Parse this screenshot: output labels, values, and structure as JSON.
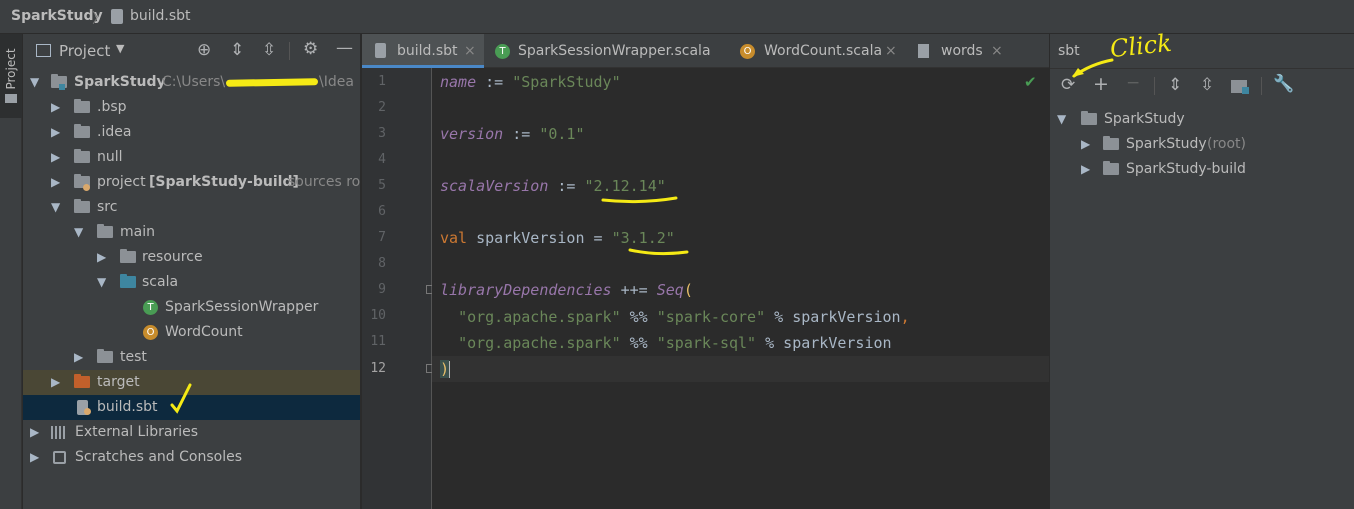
{
  "breadcrumb": {
    "project": "SparkStudy",
    "file": "build.sbt"
  },
  "left_strip": {
    "tab_label": "Project"
  },
  "project_panel": {
    "header_label": "Project",
    "tree": [
      {
        "label": "SparkStudy",
        "extra": "C:\\Users\\",
        "extra2": "\\Idea",
        "level": 0,
        "expanded": true,
        "icon": "module-folder"
      },
      {
        "label": ".bsp",
        "level": 1,
        "expanded": false,
        "icon": "folder"
      },
      {
        "label": ".idea",
        "level": 1,
        "expanded": false,
        "icon": "folder"
      },
      {
        "label": "null",
        "level": 1,
        "expanded": false,
        "icon": "folder"
      },
      {
        "label": "project",
        "bold": "[SparkStudy-build]",
        "extra": "sources roo",
        "level": 1,
        "expanded": false,
        "icon": "folder"
      },
      {
        "label": "src",
        "level": 1,
        "expanded": true,
        "icon": "folder"
      },
      {
        "label": "main",
        "level": 2,
        "expanded": true,
        "icon": "folder"
      },
      {
        "label": "resource",
        "level": 3,
        "expanded": false,
        "icon": "folder"
      },
      {
        "label": "scala",
        "level": 3,
        "expanded": true,
        "icon": "folder-blue"
      },
      {
        "label": "SparkSessionWrapper",
        "level": 4,
        "icon": "trait"
      },
      {
        "label": "WordCount",
        "level": 4,
        "icon": "object"
      },
      {
        "label": "test",
        "level": 2,
        "expanded": false,
        "icon": "folder"
      },
      {
        "label": "target",
        "level": 1,
        "expanded": false,
        "icon": "folder-orange"
      },
      {
        "label": "build.sbt",
        "level": 1,
        "icon": "sbt-file"
      },
      {
        "label": "External Libraries",
        "level": 0,
        "expanded": false,
        "icon": "libraries"
      },
      {
        "label": "Scratches and Consoles",
        "level": 0,
        "expanded": false,
        "icon": "scratches"
      }
    ]
  },
  "editor": {
    "tabs": [
      {
        "label": "build.sbt",
        "active": true
      },
      {
        "label": "SparkSessionWrapper.scala",
        "active": false
      },
      {
        "label": "WordCount.scala",
        "active": false
      },
      {
        "label": "words",
        "active": false
      }
    ],
    "line_numbers": [
      "1",
      "2",
      "3",
      "4",
      "5",
      "6",
      "7",
      "8",
      "9",
      "10",
      "11",
      "12"
    ],
    "code": {
      "l1_key": "name",
      "l1_op": " := ",
      "l1_val": "\"SparkStudy\"",
      "l3_key": "version",
      "l3_op": " := ",
      "l3_val": "\"0.1\"",
      "l5_key": "scalaVersion",
      "l5_op": " := ",
      "l5_val": "\"2.12.14\"",
      "l7_kw": "val",
      "l7_rest": " sparkVersion = ",
      "l7_val": "\"3.1.2\"",
      "l9_key": "libraryDependencies",
      "l9_op": " ++= ",
      "l9_fn": "Seq",
      "l9_paren": "(",
      "l10_s1": "\"org.apache.spark\"",
      "l10_op": " %% ",
      "l10_s2": "\"spark-core\"",
      "l10_rest": " % sparkVersion",
      "l10_comma": ",",
      "l11_s1": "\"org.apache.spark\"",
      "l11_op": " %% ",
      "l11_s2": "\"spark-sql\"",
      "l11_rest": " % sparkVersion",
      "l12": ")"
    }
  },
  "sbt_panel": {
    "title": "sbt",
    "tree": [
      {
        "label": "SparkStudy",
        "level": 0
      },
      {
        "label": "SparkStudy",
        "suffix": " (root)",
        "level": 1
      },
      {
        "label": "SparkStudy-build",
        "level": 1
      }
    ]
  },
  "annotation": {
    "click_text": "Click"
  },
  "colors": {
    "highlight": "#f5ea15",
    "accent_green": "#499c54"
  }
}
